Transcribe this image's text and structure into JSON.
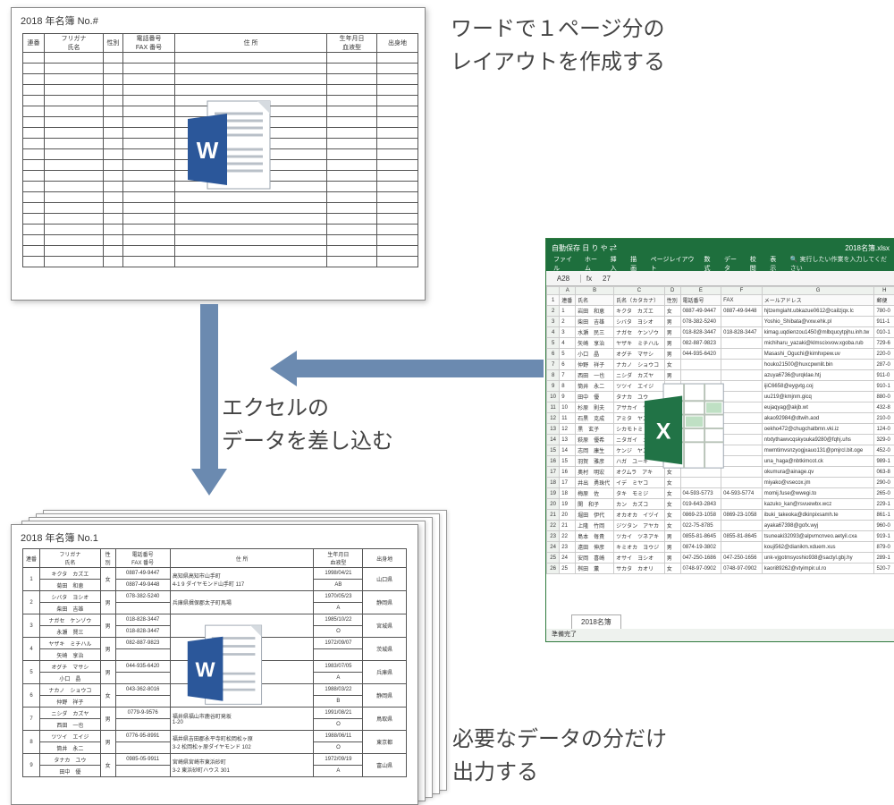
{
  "captions": {
    "top": "ワードで１ページ分の\nレイアウトを作成する",
    "mid": "エクセルの\nデータを差し込む",
    "bot": "必要なデータの分だけ\n出力する"
  },
  "word_template": {
    "title": "2018 年名簿  No.#",
    "headers": [
      "連番",
      "フリガナ\n氏名",
      "性別",
      "電話番号\nFAX 番号",
      "住 所",
      "生年月日\n血液型",
      "出身地"
    ]
  },
  "word_filled": {
    "title": "2018 年名簿  No.1",
    "rows": [
      {
        "no": "1",
        "kana": "キクタ　カズエ",
        "name": "菊田　和恵",
        "sex": "女",
        "tel": "0887-49-9447",
        "fax": "0887-49-9448",
        "addr": "高知県高知市山手町\n4-1 9 ダイヤモンド山手町 117",
        "dob": "1998/04/21",
        "bt": "AB",
        "pref": "山口県"
      },
      {
        "no": "2",
        "kana": "シバタ　ヨシオ",
        "name": "柴田　吉雄",
        "sex": "男",
        "tel": "078-382-5240",
        "fax": "",
        "addr": "兵庫県揖保郡太子町馬場",
        "dob": "1970/05/23",
        "bt": "A",
        "pref": "静岡県"
      },
      {
        "no": "3",
        "kana": "ナガセ　ケンゾウ",
        "name": "永瀬　賢三",
        "sex": "男",
        "tel": "018-828-3447",
        "fax": "018-828-3447",
        "addr": "",
        "dob": "1985/10/22",
        "bt": "O",
        "pref": "宮城県"
      },
      {
        "no": "4",
        "kana": "ヤザキ　ミチハル",
        "name": "矢崎　享治",
        "sex": "男",
        "tel": "082-887-9823",
        "fax": "",
        "addr": "",
        "dob": "1972/09/07",
        "bt": " ",
        "pref": "茨城県"
      },
      {
        "no": "5",
        "kana": "オグチ　マサシ",
        "name": "小口　晶",
        "sex": "男",
        "tel": "044-935-6420",
        "fax": "",
        "addr": "",
        "dob": "1983/07/05",
        "bt": "A",
        "pref": "兵庫県"
      },
      {
        "no": "6",
        "kana": "ナカノ　ショウコ",
        "name": "仲野　祥子",
        "sex": "女",
        "tel": "043-362-8016",
        "fax": "",
        "addr": "",
        "dob": "1988/03/22",
        "bt": "B",
        "pref": "静岡県"
      },
      {
        "no": "7",
        "kana": "ニシダ　カズヤ",
        "name": "西田　一也",
        "sex": "男",
        "tel": "0779-9-9576",
        "fax": "",
        "addr": "福井県福山市鹿谷町発坂\n1-20",
        "dob": "1991/08/21",
        "bt": "O",
        "pref": "鳥取県"
      },
      {
        "no": "8",
        "kana": "ツツイ　エイジ",
        "name": "筒井　永二",
        "sex": "男",
        "tel": "0776-95-8991",
        "fax": "",
        "addr": "福井県吉田郡永平寺町松岡松ヶ原\n3-2 松岡松ヶ原ダイヤモンド 102",
        "dob": "1988/06/11",
        "bt": "O",
        "pref": "東京都"
      },
      {
        "no": "9",
        "kana": "タナカ　ユウ",
        "name": "田中　優",
        "sex": "女",
        "tel": "0985-05-9911",
        "fax": "",
        "addr": "宮崎県宮崎市東浜砂町\n3-2 東浜砂町ハウス 301",
        "dob": "1972/09/19",
        "bt": "A",
        "pref": "富山県"
      }
    ]
  },
  "excel": {
    "filename": "2018名簿.xlsx",
    "quickbar": [
      "自動保存",
      "日",
      "り",
      "や",
      "⇄"
    ],
    "ribbon": [
      "ファイル",
      "ホーム",
      "挿入",
      "描画",
      "ページレイアウト",
      "数式",
      "データ",
      "校閲",
      "表示"
    ],
    "ribbon_hint": "実行したい作業を入力してください",
    "active_cell": "A28",
    "fx_val": "27",
    "col_letters": [
      "A",
      "B",
      "C",
      "D",
      "E",
      "F",
      "G",
      "H"
    ],
    "headers": [
      "連番",
      "氏名",
      "氏名（カタカナ）",
      "性別",
      "電話番号",
      "FAX",
      "メールアドレス",
      "郵便"
    ],
    "rows": [
      [
        "1",
        "岩田　和恵",
        "キクタ　カズエ",
        "女",
        "0887-49-9447",
        "0887-49-9448",
        "hjtzemgiaht.ubkazue0612@cailzjqx.lc",
        "780-0"
      ],
      [
        "2",
        "柴田　吉雄",
        "シバタ　ヨシオ",
        "男",
        "078-382-5240",
        "",
        "Yoshio_Shibata@vxw.ehk.pl",
        "911-1"
      ],
      [
        "3",
        "水瀬　民三",
        "ナガセ　ケンゾウ",
        "男",
        "018-828-3447",
        "018-828-3447",
        "kimag.uqdienzou1450@mlbqucytpjhu.inh.tw",
        "010-1"
      ],
      [
        "4",
        "矢崎　享治",
        "ヤザキ　ミチハル",
        "男",
        "082-887-9823",
        "",
        "michiharu_yazaki@klmscixvow.xgoba.rub",
        "729-6"
      ],
      [
        "5",
        "小口　晶",
        "オグチ　マサシ",
        "男",
        "044-935-6420",
        "",
        "Masashi_Oguchi@kimhxpew.uv",
        "220-0"
      ],
      [
        "6",
        "仲野　祥子",
        "ナカノ　ショウコ",
        "女",
        "",
        "",
        "houko21500@huxcpwnlit.bin",
        "287-0"
      ],
      [
        "7",
        "西田　一也",
        "ニシダ　カズヤ",
        "男",
        "",
        "",
        "azuya6736@urqklae.htj",
        "911-0"
      ],
      [
        "8",
        "筒井　永二",
        "ツツイ　エイジ",
        "男",
        "",
        "",
        "ijiC6658@eygvtg.coj",
        "910-1"
      ],
      [
        "9",
        "田中　優",
        "タナカ　ユウ",
        "女",
        "",
        "",
        "uu219@kmjnm.gicq",
        "880-0"
      ],
      [
        "10",
        "杉原　則夫",
        "アサカイ　ヤス",
        "男",
        "",
        "",
        "eujaqyag@akjb.wt",
        "432-8"
      ],
      [
        "11",
        "石黒　克成",
        "アミタ　ヤス",
        "女",
        "",
        "",
        "akao92984@dtwih.aod",
        "210-0"
      ],
      [
        "12",
        "黒　玄子",
        "シカモトミ　ユキ",
        "男",
        "",
        "",
        "oekho472@chugchatbmn.vki.iz",
        "124-0"
      ],
      [
        "13",
        "萩原　優希",
        "ニタガイ　ニキ",
        "男",
        "",
        "",
        "ntxtythawvcqskyouka9280@fqhj.uhs",
        "329-0"
      ],
      [
        "14",
        "志岡　康生",
        "ケンジ　ヤスト",
        "男",
        "",
        "",
        "mwmtimvsnzyogjxauo131@pmjrcl.bit.oge",
        "452-0"
      ],
      [
        "15",
        "羽賀　雅彦",
        "ハガ　ユーキ",
        "女",
        "",
        "",
        "una_haga@nbtkimcot.ck",
        "989-1"
      ],
      [
        "16",
        "奥村　明宏",
        "オクムラ　アキ",
        "女",
        "",
        "",
        "okumura@ainage.qv",
        "063-8"
      ],
      [
        "17",
        "井出　勇珠代",
        "イデ　ミヤコ",
        "女",
        "",
        "",
        "miyako@vsecox.jm",
        "290-0"
      ],
      [
        "18",
        "梅原　佐",
        "タキ　モミジ",
        "女",
        "04-593-5773",
        "04-593-5774",
        "momij.fuse@wwegi.to",
        "265-0"
      ],
      [
        "19",
        "関　和子",
        "カン　カズコ",
        "女",
        "019-643-2843",
        "",
        "kazuko_kan@rsvuewbx.wcz",
        "229-1"
      ],
      [
        "20",
        "堀田　伊代",
        "オカオカ　イヅイ",
        "女",
        "0869-23-1058",
        "0869-23-1058",
        "ibuki_takeoka@dkinpixsamh.te",
        "861-1"
      ],
      [
        "21",
        "上隆　竹岡",
        "ジツタン　アヤカ",
        "女",
        "022-75-8785",
        "",
        "ayaka67398@gofx.wyj",
        "960-0"
      ],
      [
        "22",
        "島本　毎貴",
        "ツカイ　ツネアキ",
        "男",
        "0855-81-8645",
        "0855-81-8645",
        "tsuneaki32093@alpvmcnveo.aetyil.cxa",
        "919-1"
      ],
      [
        "23",
        "遠田　伸彦",
        "キミオカ　ヨウジ",
        "男",
        "0874-19-3802",
        "",
        "kouji562@dianikm.xduem.xus",
        "879-0"
      ],
      [
        "24",
        "安岡　喜崎",
        "オサイ　ヨシオ",
        "男",
        "047-250-1686",
        "047-250-1656",
        "unk-vjgotmsyoshio938@sactyl.gbj.hy",
        "289-1"
      ],
      [
        "25",
        "桝田　薫",
        "サカタ　カオリ",
        "女",
        "0748-97-0902",
        "0748-97-0902",
        "kaori89262@vtyimpir.ul.ro",
        "520-7"
      ]
    ],
    "sheet_tab": "2018名簿",
    "status": "準備完了"
  }
}
